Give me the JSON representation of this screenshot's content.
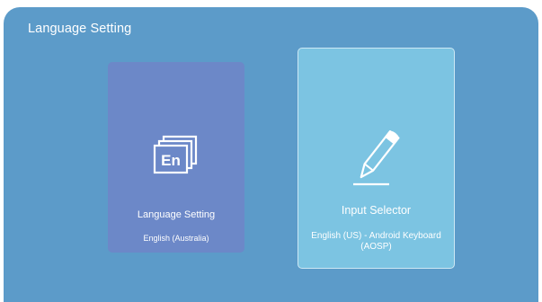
{
  "header": {
    "title": "Language Setting"
  },
  "cards": [
    {
      "label": "Language Setting",
      "value": "English (Australia)",
      "icon": "language-en-icon",
      "focused": false,
      "color": "#6c88c8"
    },
    {
      "label": "Input Selector",
      "value": "English (US) - Android Keyboard (AOSP)",
      "icon": "pencil-icon",
      "focused": true,
      "color": "#7cc4e2"
    }
  ],
  "icon_text": {
    "language": "En"
  },
  "colors": {
    "background": "#5c9bc9",
    "text": "#ffffff"
  }
}
